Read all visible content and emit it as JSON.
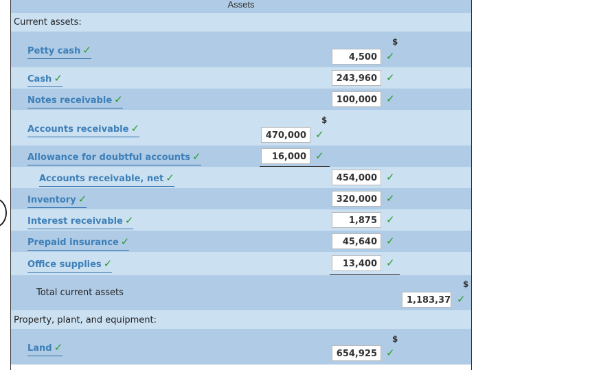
{
  "header": {
    "title": "Assets"
  },
  "sections": {
    "current_assets": "Current assets:",
    "ppe": "Property, plant, and equipment:"
  },
  "currency": "$",
  "check_glyph": "✓",
  "rows": {
    "petty_cash": {
      "label": "Petty cash",
      "value": "4,500"
    },
    "cash": {
      "label": "Cash",
      "value": "243,960"
    },
    "notes_receivable": {
      "label": "Notes receivable",
      "value": "100,000"
    },
    "accounts_receivable": {
      "label": "Accounts receivable",
      "value": "470,000"
    },
    "allowance": {
      "label": "Allowance for doubtful accounts",
      "value": "16,000"
    },
    "ar_net": {
      "label": "Accounts receivable, net",
      "value": "454,000"
    },
    "inventory": {
      "label": "Inventory",
      "value": "320,000"
    },
    "interest_receivable": {
      "label": "Interest receivable",
      "value": "1,875"
    },
    "prepaid_insurance": {
      "label": "Prepaid insurance",
      "value": "45,640"
    },
    "office_supplies": {
      "label": "Office supplies",
      "value": "13,400"
    },
    "total_current_assets": {
      "label": "Total current assets",
      "value": "1,183,37"
    },
    "land": {
      "label": "Land",
      "value": "654,925"
    }
  }
}
